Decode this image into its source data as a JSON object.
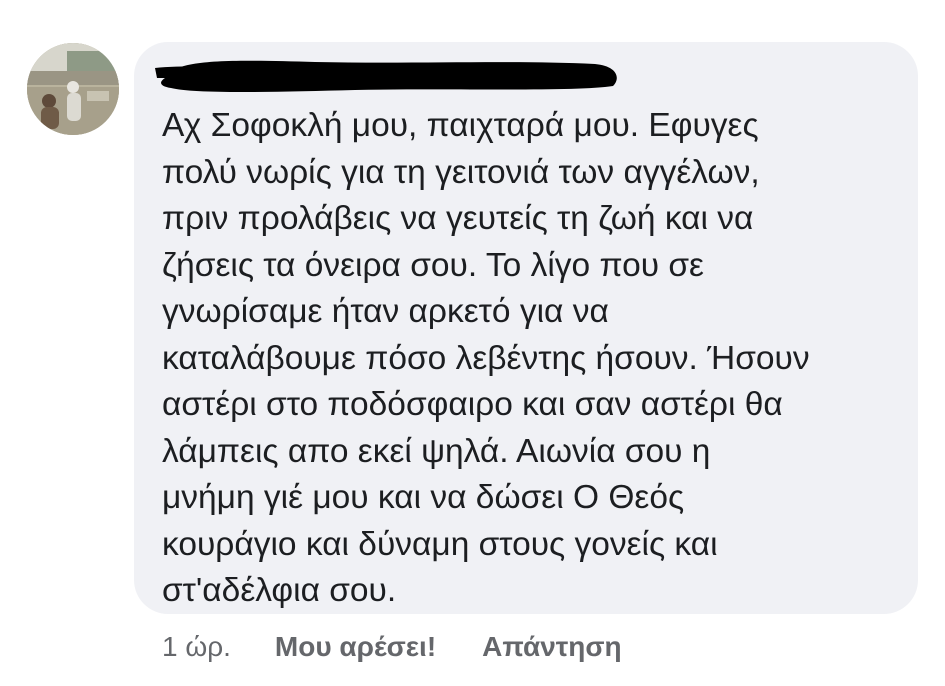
{
  "comment": {
    "text": "Αχ Σοφοκλή μου, παιχταρά μου. Εφυγες\nπολύ νωρίς για τη γειτονιά των αγγέλων,\nπριν προλάβεις να γευτείς τη ζωή και να\nζήσεις τα όνειρα σου. Το λίγο που σε\nγνωρίσαμε ήταν αρκετό για να\nκαταλάβουμε πόσο λεβέντης ήσουν. Ήσουν\nαστέρι  στο ποδόσφαιρο και σαν αστέρι θα\nλάμπεις απο εκεί ψηλά. Αιωνία σου η\nμνήμη γιέ μου και να δώσει Ο Θεός\nκουράγιο και δύναμη στους γονείς και\nστ'αδέλφια σου."
  },
  "actions": {
    "time": "1 ώρ.",
    "like_label": "Μου αρέσει!",
    "reply_label": "Απάντηση"
  },
  "colors": {
    "bubble": "#f0f1f5",
    "text": "#1c1e21",
    "meta": "#65676b"
  }
}
